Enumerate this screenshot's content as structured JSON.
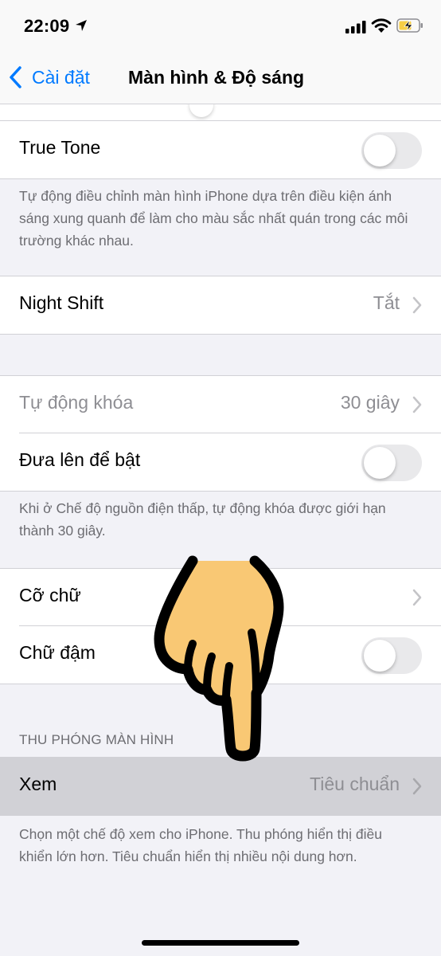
{
  "status_bar": {
    "time": "22:09"
  },
  "nav": {
    "back_label": "Cài đặt",
    "title": "Màn hình & Độ sáng"
  },
  "true_tone": {
    "label": "True Tone",
    "enabled": false,
    "footnote": "Tự động điều chỉnh màn hình iPhone dựa trên điều kiện ánh sáng xung quanh để làm cho màu sắc nhất quán trong các môi trường khác nhau."
  },
  "night_shift": {
    "label": "Night Shift",
    "value": "Tắt"
  },
  "auto_lock": {
    "label": "Tự động khóa",
    "value": "30 giây"
  },
  "raise_to_wake": {
    "label": "Đưa lên để bật",
    "enabled": false,
    "footnote": "Khi ở Chế độ nguồn điện thấp, tự động khóa được giới hạn thành 30 giây."
  },
  "text_size": {
    "label": "Cỡ chữ"
  },
  "bold_text": {
    "label": "Chữ đậm",
    "enabled": false
  },
  "display_zoom": {
    "header": "THU PHÓNG MÀN HÌNH",
    "view_label": "Xem",
    "view_value": "Tiêu chuẩn",
    "footnote": "Chọn một chế độ xem cho iPhone. Thu phóng hiển thị điều khiển lớn hơn. Tiêu chuẩn hiển thị nhiều nội dung hơn."
  },
  "icons": {
    "location": "location-arrow-icon",
    "signal": "cellular-signal-icon",
    "wifi": "wifi-icon",
    "battery": "battery-charging-icon",
    "back": "chevron-left-icon",
    "chevron": "chevron-right-icon",
    "pointer": "pointing-hand-icon"
  },
  "colors": {
    "accent": "#007aff",
    "background": "#f2f2f7",
    "toggle_off": "#e9e9eb",
    "battery_fill": "#f7ce46",
    "hand_fill": "#f9c874"
  }
}
